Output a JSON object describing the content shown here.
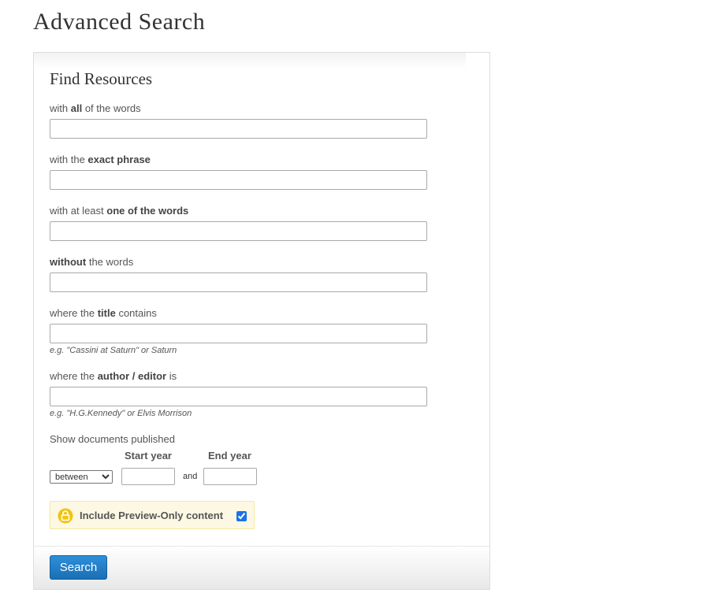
{
  "page": {
    "title": "Advanced Search"
  },
  "form": {
    "title": "Find Resources",
    "all_words": {
      "label_pre": "with ",
      "label_bold": "all",
      "label_post": " of the words",
      "value": ""
    },
    "exact_phrase": {
      "label_pre": "with the ",
      "label_bold": "exact phrase",
      "label_post": "",
      "value": ""
    },
    "one_of_words": {
      "label_pre": "with at least ",
      "label_bold": "one of the words",
      "label_post": "",
      "value": ""
    },
    "without_words": {
      "label_pre": "",
      "label_bold": "without",
      "label_post": " the words",
      "value": ""
    },
    "title_contains": {
      "label_pre": "where the ",
      "label_bold": "title",
      "label_post": " contains",
      "value": "",
      "hint": "e.g. \"Cassini at Saturn\" or Saturn"
    },
    "author_editor": {
      "label_pre": "where the ",
      "label_bold": "author / editor",
      "label_post": " is",
      "value": "",
      "hint": "e.g. \"H.G.Kennedy\" or Elvis Morrison"
    },
    "published": {
      "label": "Show documents published",
      "start_year_label": "Start year",
      "end_year_label": "End year",
      "range_selected": "between",
      "and_text": "and",
      "start_year_value": "",
      "end_year_value": ""
    },
    "preview": {
      "label": "Include Preview-Only content",
      "checked": true
    },
    "search_button_label": "Search"
  },
  "colors": {
    "primary_button": "#1a78c2",
    "preview_background": "#fcf8e3",
    "lock_icon": "#f1c40f"
  }
}
